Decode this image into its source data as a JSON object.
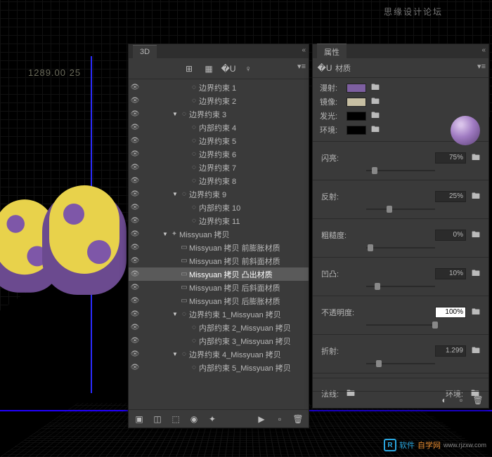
{
  "watermark_top": "思缘设计论坛",
  "watermark_br": {
    "brand1": "软件",
    "brand2": "自学网",
    "url": "www.rjzxw.com"
  },
  "viewport": {
    "coord": "1289.00  25"
  },
  "panel3d": {
    "title": "3D",
    "tree": [
      {
        "depth": 3,
        "tw": "",
        "icon": "◌",
        "label": "边界约束 1"
      },
      {
        "depth": 3,
        "tw": "",
        "icon": "◌",
        "label": "边界约束 2"
      },
      {
        "depth": 2,
        "tw": "▼",
        "icon": "◌",
        "label": "边界约束 3"
      },
      {
        "depth": 3,
        "tw": "",
        "icon": "◌",
        "label": "内部约束 4"
      },
      {
        "depth": 3,
        "tw": "",
        "icon": "◌",
        "label": "边界约束 5"
      },
      {
        "depth": 3,
        "tw": "",
        "icon": "◌",
        "label": "边界约束 6"
      },
      {
        "depth": 3,
        "tw": "",
        "icon": "◌",
        "label": "边界约束 7"
      },
      {
        "depth": 3,
        "tw": "",
        "icon": "◌",
        "label": "边界约束 8"
      },
      {
        "depth": 2,
        "tw": "▼",
        "icon": "◌",
        "label": "边界约束 9"
      },
      {
        "depth": 3,
        "tw": "",
        "icon": "◌",
        "label": "内部约束 10"
      },
      {
        "depth": 3,
        "tw": "",
        "icon": "◌",
        "label": "边界约束 11"
      },
      {
        "depth": 1,
        "tw": "▼",
        "icon": "✦",
        "label": "Missyuan 拷贝"
      },
      {
        "depth": 2,
        "tw": "",
        "icon": "▭",
        "label": "Missyuan 拷贝 前膨胀材质"
      },
      {
        "depth": 2,
        "tw": "",
        "icon": "▭",
        "label": "Missyuan 拷贝 前斜面材质"
      },
      {
        "depth": 2,
        "tw": "",
        "icon": "▭",
        "label": "Missyuan 拷贝 凸出材质",
        "sel": true
      },
      {
        "depth": 2,
        "tw": "",
        "icon": "▭",
        "label": "Missyuan 拷贝 后斜面材质"
      },
      {
        "depth": 2,
        "tw": "",
        "icon": "▭",
        "label": "Missyuan 拷贝 后膨胀材质"
      },
      {
        "depth": 2,
        "tw": "▼",
        "icon": "◌",
        "label": "边界约束 1_Missyuan 拷贝"
      },
      {
        "depth": 3,
        "tw": "",
        "icon": "◌",
        "label": "内部约束 2_Missyuan 拷贝"
      },
      {
        "depth": 3,
        "tw": "",
        "icon": "◌",
        "label": "内部约束 3_Missyuan 拷贝"
      },
      {
        "depth": 2,
        "tw": "▼",
        "icon": "◌",
        "label": "边界约束 4_Missyuan 拷贝"
      },
      {
        "depth": 3,
        "tw": "",
        "icon": "◌",
        "label": "内部约束 5_Missyuan 拷贝"
      }
    ]
  },
  "panelProp": {
    "title": "属性",
    "subtitle": "材质",
    "swatches": [
      {
        "label": "漫射:",
        "color": "#7d5fa0"
      },
      {
        "label": "镜像:",
        "color": "#c7bfa3"
      },
      {
        "label": "发光:",
        "color": "#000"
      },
      {
        "label": "环境:",
        "color": "#000"
      }
    ],
    "sliders": [
      {
        "label": "闪亮:",
        "value": "75%",
        "pos": 8
      },
      {
        "label": "反射:",
        "value": "25%",
        "pos": 30
      },
      {
        "label": "粗糙度:",
        "value": "0%",
        "pos": 2
      },
      {
        "label": "凹凸:",
        "value": "10%",
        "pos": 12
      },
      {
        "label": "不透明度:",
        "value": "100%",
        "pos": 96,
        "active": true
      },
      {
        "label": "折射:",
        "value": "1.299",
        "pos": 14
      }
    ],
    "bottom": {
      "l1": "法线:",
      "l2": "环境:"
    }
  }
}
